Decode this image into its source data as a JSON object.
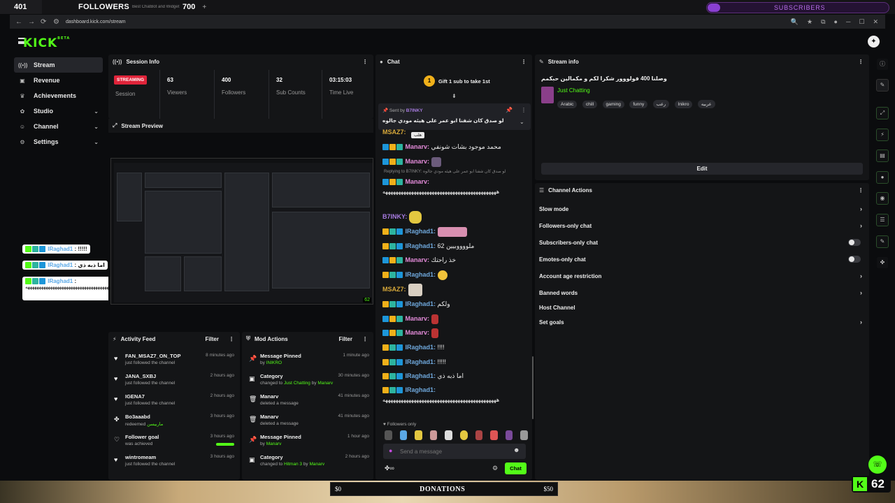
{
  "topbar": {
    "count": "401",
    "followers_label": "FOLLOWERS",
    "subtext": "Best ChatBot and Widget",
    "goal": "700",
    "tab_add": "+",
    "subscribers_label": "SUBSCRIBERS"
  },
  "browser": {
    "url": "dashboard.kick.com/stream"
  },
  "app": {
    "logo": "KICK",
    "logo_sup": "BETA"
  },
  "sidebar": {
    "items": [
      {
        "label": "Stream",
        "icon": "stream-icon"
      },
      {
        "label": "Revenue",
        "icon": "dollar-icon"
      },
      {
        "label": "Achievements",
        "icon": "trophy-icon"
      },
      {
        "label": "Studio",
        "icon": "gear-icon"
      },
      {
        "label": "Channel",
        "icon": "user-icon"
      },
      {
        "label": "Settings",
        "icon": "gear-icon"
      }
    ]
  },
  "session": {
    "title": "Session Info",
    "status": "STREAMING",
    "session_label": "Session",
    "stats": [
      {
        "value": "63",
        "label": "Viewers"
      },
      {
        "value": "400",
        "label": "Followers"
      },
      {
        "value": "32",
        "label": "Sub Counts"
      },
      {
        "value": "03:15:03",
        "label": "Time Live"
      }
    ]
  },
  "preview": {
    "title": "Stream Preview",
    "viewers": "62"
  },
  "overlay": {
    "msgs": [
      {
        "user": "IRaghad1",
        "text": "!!!!!"
      },
      {
        "user": "IRaghad1",
        "text": "اما ذبه ذي"
      },
      {
        "user": "IRaghad1",
        "text": "ههههههههههههههههههههههههههههههههههههههههههههههههههه"
      }
    ]
  },
  "activity": {
    "title": "Activity Feed",
    "filter": "Filter",
    "rows": [
      {
        "name": "FAN_MSAZ7_ON_TOP",
        "sub": "just followed the channel",
        "time": "8 minutes ago"
      },
      {
        "name": "JANA_SXBJ",
        "sub": "just followed the channel",
        "time": "2 hours ago"
      },
      {
        "name": "IGENA7",
        "sub": "just followed the channel",
        "time": "2 hours ago"
      },
      {
        "name": "Bo3aaabd",
        "sub": "redeemed",
        "sub_green": "ماربيسن",
        "time": "3 hours ago"
      },
      {
        "name": "Follower goal",
        "sub": "was achieved",
        "time": "3 hours ago"
      },
      {
        "name": "wintromeam",
        "sub": "just followed the channel",
        "time": "3 hours ago"
      }
    ]
  },
  "mod": {
    "title": "Mod Actions",
    "filter": "Filter",
    "rows": [
      {
        "name": "Message Pinned",
        "sub": "by",
        "sub_green": "INIKRO",
        "time": "1 minute ago"
      },
      {
        "name": "Category",
        "sub": "changed to",
        "sub_green": "Just Chatting",
        "sub2": "by",
        "sub_green2": "Manarv",
        "time": "30 minutes ago"
      },
      {
        "name": "Manarv",
        "sub": "deleted a message",
        "time": "41 minutes ago"
      },
      {
        "name": "Manarv",
        "sub": "deleted a message",
        "time": "41 minutes ago"
      },
      {
        "name": "Message Pinned",
        "sub": "by",
        "sub_green": "Manarv",
        "time": "1 hour ago"
      },
      {
        "name": "Category",
        "sub": "changed to",
        "sub_green": "Hitman 3",
        "sub2": "by",
        "sub_green2": "Manarv",
        "time": "2 hours ago"
      }
    ]
  },
  "chat": {
    "title": "Chat",
    "gift": "Gift 1 sub to take 1st",
    "gift_num": "1",
    "pinned_by_label": "Sent by",
    "pinned_by": "B7INKY",
    "pinned_text": "لو صدق كان شفنا ابو عمر على هيئه مودي جالوه",
    "tooltip": "هلب",
    "replying": "Replying to B7INKY: لو صدق كان شفنا ابو عمر على هيئه مودي جالوه",
    "lines": [
      {
        "user": "MSAZ7:",
        "cls": "u-ms",
        "text": ""
      },
      {
        "user": "Manarv:",
        "cls": "u-man",
        "text": "محمد موجود بشات شونفي"
      },
      {
        "user": "Manarv:",
        "cls": "u-man",
        "text": ""
      },
      {
        "user": "Manarv:",
        "cls": "u-man",
        "text": "ههههههههههههههههههههههههههههههههههههههههههههه"
      },
      {
        "user": "B7INKY:",
        "cls": "u-b7",
        "text": ""
      },
      {
        "user": "IRaghad1:",
        "cls": "u-ir",
        "text": ""
      },
      {
        "user": "IRaghad1:",
        "cls": "u-ir",
        "text": "62 ملووووبيين"
      },
      {
        "user": "Manarv:",
        "cls": "u-man",
        "text": "خذ راحتك"
      },
      {
        "user": "IRaghad1:",
        "cls": "u-ir",
        "text": ""
      },
      {
        "user": "MSAZ7:",
        "cls": "u-ms",
        "text": ""
      },
      {
        "user": "IRaghad1:",
        "cls": "u-ir",
        "text": "ولكم"
      },
      {
        "user": "Manarv:",
        "cls": "u-man",
        "text": ""
      },
      {
        "user": "Manarv:",
        "cls": "u-man",
        "text": ""
      },
      {
        "user": "IRaghad1:",
        "cls": "u-ir",
        "text": "!!!!"
      },
      {
        "user": "IRaghad1:",
        "cls": "u-ir",
        "text": "!!!!!"
      },
      {
        "user": "IRaghad1:",
        "cls": "u-ir",
        "text": "اما ذبه ذي"
      },
      {
        "user": "IRaghad1:",
        "cls": "u-ir",
        "text": "ههههههههههههههههههههههههههههههههههههههههههههه"
      }
    ],
    "followers_only": "Followers only",
    "placeholder": "Send a message",
    "send": "Chat"
  },
  "streaminfo": {
    "title": "Stream info",
    "stream_title": "وصلنا 400 فولووور شكرا لكم و مكمالين حبكمم",
    "category": "Just Chatting",
    "tags": [
      "Arabic",
      "chill",
      "gaming",
      "funny",
      "رعب",
      "Inikro",
      "عربيه"
    ],
    "edit": "Edit"
  },
  "actions": {
    "title": "Channel Actions",
    "rows": [
      {
        "label": "Slow mode",
        "kind": "chev"
      },
      {
        "label": "Followers-only chat",
        "kind": "chev"
      },
      {
        "label": "Subscribers-only chat",
        "kind": "toggle"
      },
      {
        "label": "Emotes-only chat",
        "kind": "toggle"
      },
      {
        "label": "Account age restriction",
        "kind": "chev"
      },
      {
        "label": "Banned words",
        "kind": "chev"
      },
      {
        "label": "Host Channel",
        "kind": "none"
      },
      {
        "label": "Set goals",
        "kind": "chev"
      }
    ]
  },
  "bottom": {
    "left": "$0",
    "donations": "DONATIONS",
    "right": "$50",
    "viewers": "62",
    "k": "K"
  },
  "colors": {
    "accent": "#53fc18",
    "streaming": "#e0243a",
    "panel": "#141517"
  }
}
